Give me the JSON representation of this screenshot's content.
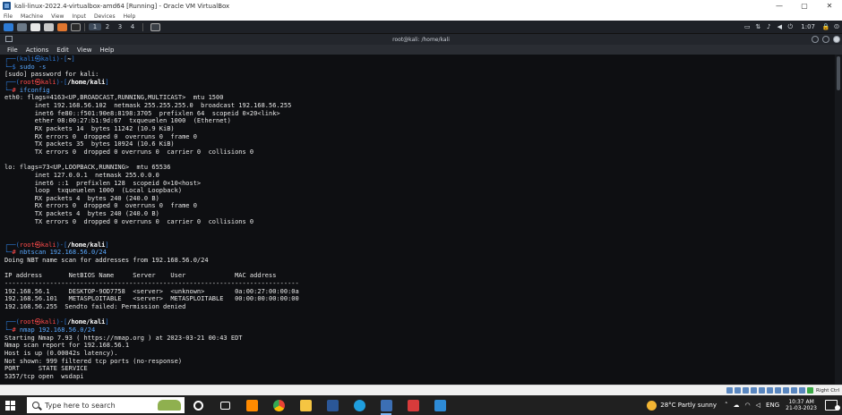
{
  "vbox": {
    "title": "kali-linux-2022.4-virtualbox-amd64 [Running] - Oracle VM VirtualBox",
    "menu": [
      "File",
      "Machine",
      "View",
      "Input",
      "Devices",
      "Help"
    ],
    "status_right": "Right Ctrl"
  },
  "kali_panel": {
    "workspaces": [
      "1",
      "2",
      "3",
      "4"
    ],
    "clock": "1:07"
  },
  "terminal": {
    "title": "root@kali: /home/kali",
    "menu": [
      "File",
      "Actions",
      "Edit",
      "View",
      "Help"
    ],
    "lines": [
      {
        "t": "prompt_user",
        "user": "kali",
        "host": "kali",
        "dir": "~"
      },
      {
        "t": "cmd",
        "text": "sudo -s"
      },
      {
        "t": "out",
        "text": "[sudo] password for kali:"
      },
      {
        "t": "prompt_root",
        "user": "root",
        "host": "kali",
        "dir": "/home/kali"
      },
      {
        "t": "cmd",
        "text": "ifconfig"
      },
      {
        "t": "out",
        "text": "eth0: flags=4163<UP,BROADCAST,RUNNING,MULTICAST>  mtu 1500"
      },
      {
        "t": "out",
        "text": "        inet 192.168.56.102  netmask 255.255.255.0  broadcast 192.168.56.255"
      },
      {
        "t": "out",
        "text": "        inet6 fe80::f501:90e8:8198:3705  prefixlen 64  scopeid 0×20<link>"
      },
      {
        "t": "out",
        "text": "        ether 08:00:27:b1:9d:67  txqueuelen 1000  (Ethernet)"
      },
      {
        "t": "out",
        "text": "        RX packets 14  bytes 11242 (10.9 KiB)"
      },
      {
        "t": "out",
        "text": "        RX errors 0  dropped 0  overruns 0  frame 0"
      },
      {
        "t": "out",
        "text": "        TX packets 35  bytes 10924 (10.6 KiB)"
      },
      {
        "t": "out",
        "text": "        TX errors 0  dropped 0 overruns 0  carrier 0  collisions 0"
      },
      {
        "t": "out",
        "text": ""
      },
      {
        "t": "out",
        "text": "lo: flags=73<UP,LOOPBACK,RUNNING>  mtu 65536"
      },
      {
        "t": "out",
        "text": "        inet 127.0.0.1  netmask 255.0.0.0"
      },
      {
        "t": "out",
        "text": "        inet6 ::1  prefixlen 128  scopeid 0×10<host>"
      },
      {
        "t": "out",
        "text": "        loop  txqueuelen 1000  (Local Loopback)"
      },
      {
        "t": "out",
        "text": "        RX packets 4  bytes 240 (240.0 B)"
      },
      {
        "t": "out",
        "text": "        RX errors 0  dropped 0  overruns 0  frame 0"
      },
      {
        "t": "out",
        "text": "        TX packets 4  bytes 240 (240.0 B)"
      },
      {
        "t": "out",
        "text": "        TX errors 0  dropped 0 overruns 0  carrier 0  collisions 0"
      },
      {
        "t": "out",
        "text": ""
      },
      {
        "t": "out",
        "text": ""
      },
      {
        "t": "prompt_root",
        "user": "root",
        "host": "kali",
        "dir": "/home/kali"
      },
      {
        "t": "cmd",
        "text": "nbtscan 192.168.56.0/24"
      },
      {
        "t": "out",
        "text": "Doing NBT name scan for addresses from 192.168.56.0/24"
      },
      {
        "t": "out",
        "text": ""
      },
      {
        "t": "out",
        "text": "IP address       NetBIOS Name     Server    User             MAC address"
      },
      {
        "t": "rule",
        "text": "------------------------------------------------------------------------------"
      },
      {
        "t": "out",
        "text": "192.168.56.1     DESKTOP-9OD7758  <server>  <unknown>        0a:00:27:00:00:0a"
      },
      {
        "t": "out",
        "text": "192.168.56.101   METASPLOITABLE   <server>  METASPLOITABLE   00:00:00:00:00:00"
      },
      {
        "t": "out",
        "text": "192.168.56.255  Sendto failed: Permission denied"
      },
      {
        "t": "out",
        "text": ""
      },
      {
        "t": "prompt_root",
        "user": "root",
        "host": "kali",
        "dir": "/home/kali"
      },
      {
        "t": "cmd",
        "text": "nmap 192.168.56.0/24"
      },
      {
        "t": "out",
        "text": "Starting Nmap 7.93 ( https://nmap.org ) at 2023-03-21 00:43 EDT"
      },
      {
        "t": "out",
        "text": "Nmap scan report for 192.168.56.1"
      },
      {
        "t": "out",
        "text": "Host is up (0.00042s latency)."
      },
      {
        "t": "out",
        "text": "Not shown: 999 filtered tcp ports (no-response)"
      },
      {
        "t": "out",
        "text": "PORT     STATE SERVICE"
      },
      {
        "t": "out",
        "text": "5357/tcp open  wsdapi"
      }
    ]
  },
  "taskbar": {
    "search_placeholder": "Type here to search",
    "weather": "28°C  Partly sunny",
    "lang": "ENG",
    "time": "10:37 AM",
    "date": "21-03-2023",
    "apps": [
      "task-view",
      "sublime-text",
      "chrome",
      "file-explorer",
      "word",
      "edge",
      "virtualbox",
      "remote-app",
      "photos"
    ],
    "colors": {
      "prompt_blue": "#2f7bd8",
      "prompt_red": "#ff4b4b",
      "taskbar_bg": "#202020"
    }
  }
}
